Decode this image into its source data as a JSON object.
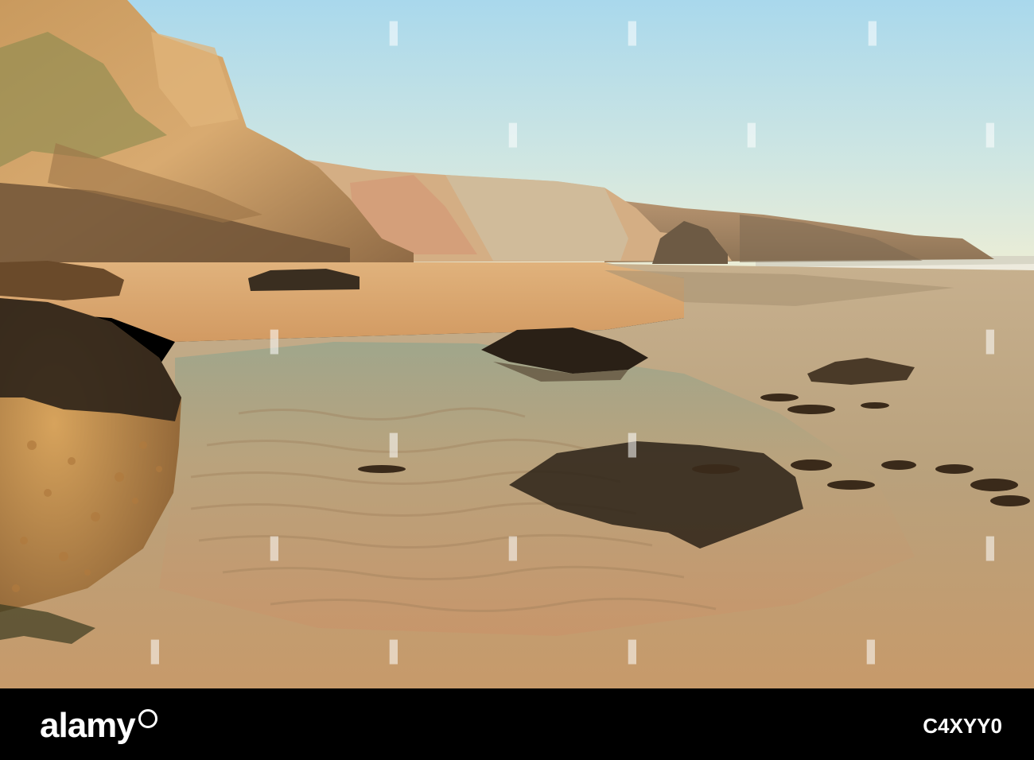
{
  "footer": {
    "brand": "alamy",
    "stock_id": "C4XYY0"
  },
  "colors": {
    "sky_top": "#a9d8ec",
    "sky_bottom": "#ecedd5",
    "cliff_light": "#d9a86a",
    "cliff_shadow": "#6e5236",
    "sand": "#d9a46c",
    "wet_sand": "#c8a278",
    "rock_dark": "#2a2016",
    "footer_bg": "#000000"
  },
  "icons": {
    "brand_mark": "alamy-logo-icon"
  }
}
